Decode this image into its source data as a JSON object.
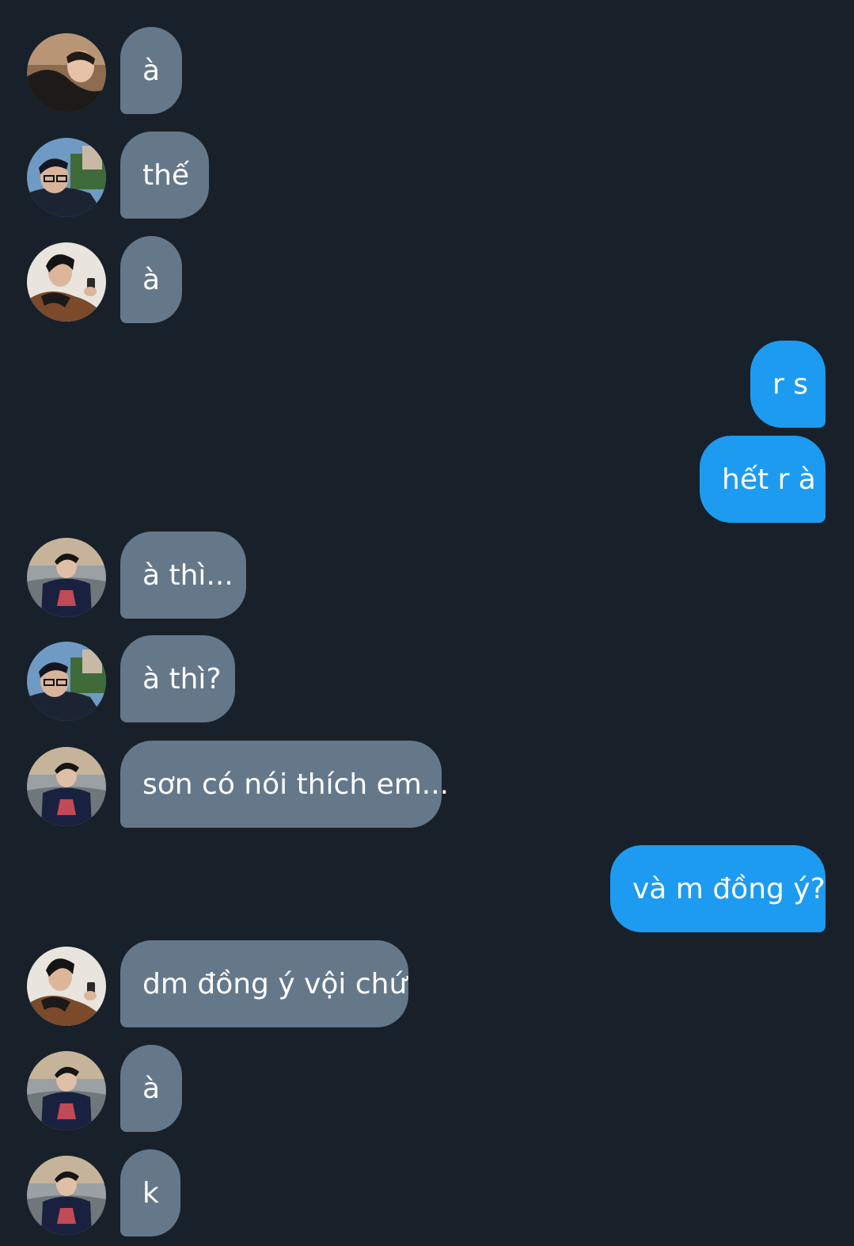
{
  "colors": {
    "background": "#18202a",
    "incoming_bubble": "#65788a",
    "outgoing_bubble": "#1d9bf0",
    "text": "#ffffff"
  },
  "messages": [
    {
      "side": "incoming",
      "avatar": "avatar-leather-jacket",
      "text": "à"
    },
    {
      "side": "incoming",
      "avatar": "avatar-glasses-trees",
      "text": "thế"
    },
    {
      "side": "incoming",
      "avatar": "avatar-brown-jacket",
      "text": "à"
    },
    {
      "side": "outgoing",
      "text": "r s"
    },
    {
      "side": "outgoing",
      "text": "hết r à"
    },
    {
      "side": "incoming",
      "avatar": "avatar-navy-sweater",
      "text": "à thì..."
    },
    {
      "side": "incoming",
      "avatar": "avatar-glasses-trees",
      "text": "à thì?"
    },
    {
      "side": "incoming",
      "avatar": "avatar-navy-sweater",
      "text": "sơn có nói thích em..."
    },
    {
      "side": "outgoing",
      "text": "và m đồng ý?"
    },
    {
      "side": "incoming",
      "avatar": "avatar-brown-jacket",
      "text": "dm đồng ý vội chứ"
    },
    {
      "side": "incoming",
      "avatar": "avatar-navy-sweater",
      "text": "à"
    },
    {
      "side": "incoming",
      "avatar": "avatar-navy-sweater",
      "text": "k"
    }
  ]
}
